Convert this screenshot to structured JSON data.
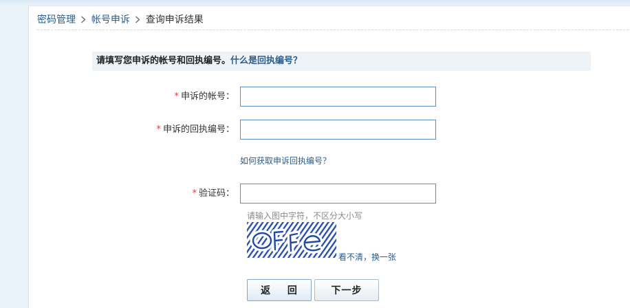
{
  "breadcrumb": {
    "items": [
      "密码管理",
      "帐号申诉",
      "查询申诉结果"
    ]
  },
  "notice": {
    "text": "请填写您申诉的帐号和回执编号。",
    "link_text": "什么是回执编号？"
  },
  "form": {
    "required_mark": "*",
    "account_label": "申诉的帐号：",
    "account_value": "",
    "receipt_label": "申诉的回执编号：",
    "receipt_value": "",
    "receipt_help_link": "如何获取申诉回执编号？",
    "captcha_label": "验证码：",
    "captcha_value": "",
    "captcha_hint": "请输入图中字符，不区分大小写",
    "captcha_refresh_link": "看不清，换一张"
  },
  "buttons": {
    "back_label": "返 回",
    "next_label": "下一步"
  },
  "colors": {
    "link": "#2a5d8c",
    "required": "#e03a3a",
    "input_border": "#5b8ec2",
    "notice_bg": "#eef3f8",
    "captcha_ink": "#1f49a6"
  }
}
